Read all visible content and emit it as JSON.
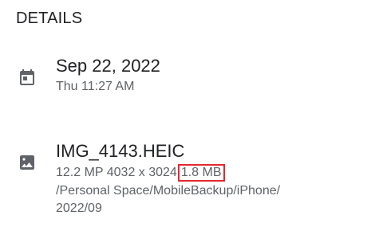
{
  "section": {
    "title": "DETAILS"
  },
  "date_row": {
    "icon": "calendar-icon",
    "date": "Sep 22, 2022",
    "time": "Thu 11:27 AM"
  },
  "file_row": {
    "icon": "image-icon",
    "filename": "IMG_4143.HEIC",
    "dimensions": "12.2 MP 4032 x 3024",
    "size": "1.8 MB",
    "path_line1": "/Personal Space/MobileBackup/iPhone/",
    "path_line2": "2022/09"
  },
  "colors": {
    "highlight_border": "#e3282f",
    "icon": "#5f6368"
  }
}
